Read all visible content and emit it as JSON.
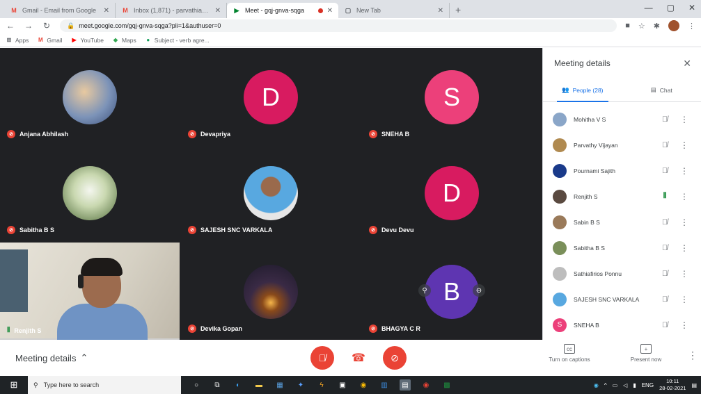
{
  "browser": {
    "tabs": [
      {
        "favicon": "gmail-icon",
        "title": "Gmail - Email from Google",
        "active": false
      },
      {
        "favicon": "gmail-icon",
        "title": "Inbox (1,871) - parvathiababu6...",
        "active": false
      },
      {
        "favicon": "meet-icon",
        "title": "Meet - gqj-gnva-sqga",
        "active": true
      },
      {
        "favicon": "newtab-icon",
        "title": "New Tab",
        "active": false
      }
    ],
    "url": "meet.google.com/gqj-gnva-sqga?pli=1&authuser=0",
    "bookmarks": [
      "Apps",
      "Gmail",
      "YouTube",
      "Maps",
      "Subject - verb agre..."
    ]
  },
  "tiles": [
    {
      "name": "Anjana Abhilash",
      "initial": "",
      "color": "#5b7fb5",
      "mic": "off"
    },
    {
      "name": "Devapriya",
      "initial": "D",
      "color": "#d81b60",
      "mic": "off"
    },
    {
      "name": "SNEHA B",
      "initial": "S",
      "color": "#ec407a",
      "mic": "off"
    },
    {
      "name": "Sabitha B S",
      "initial": "",
      "color": "#7a8f5a",
      "mic": "off"
    },
    {
      "name": "SAJESH SNC VARKALA",
      "initial": "",
      "color": "#58a8e0",
      "mic": "off"
    },
    {
      "name": "Devu Devu",
      "initial": "D",
      "color": "#d81b60",
      "mic": "off"
    },
    {
      "name": "Renjith S",
      "initial": "",
      "color": "",
      "mic": "on"
    },
    {
      "name": "Devika Gopan",
      "initial": "",
      "color": "#3a2a45",
      "mic": "off"
    },
    {
      "name": "BHAGYA C R",
      "initial": "B",
      "color": "#5e35b1",
      "mic": "off"
    }
  ],
  "panel": {
    "title": "Meeting details",
    "tabs": {
      "people": "People (28)",
      "chat": "Chat"
    },
    "people": [
      {
        "name": "Mohitha V S",
        "color": "#8aa6c8",
        "initial": "",
        "mic": "off"
      },
      {
        "name": "Parvathy Vijayan",
        "color": "#b08a50",
        "initial": "",
        "mic": "off"
      },
      {
        "name": "Pournami Sajith",
        "color": "#1a3a8a",
        "initial": "",
        "mic": "off"
      },
      {
        "name": "Renjith S",
        "color": "#5a4a40",
        "initial": "",
        "mic": "on"
      },
      {
        "name": "Sabin B S",
        "color": "#9a7a5a",
        "initial": "",
        "mic": "off"
      },
      {
        "name": "Sabitha B S",
        "color": "#7a8f5a",
        "initial": "",
        "mic": "off"
      },
      {
        "name": "Sathiafirios Ponnu",
        "color": "#bdbdbd",
        "initial": "",
        "mic": "off"
      },
      {
        "name": "SAJESH SNC VARKALA",
        "color": "#58a8e0",
        "initial": "",
        "mic": "off"
      },
      {
        "name": "SNEHA B",
        "color": "#ec407a",
        "initial": "S",
        "mic": "off"
      }
    ]
  },
  "bottom": {
    "meeting_details": "Meeting details",
    "captions": "Turn on captions",
    "present": "Present now"
  },
  "taskbar": {
    "search_placeholder": "Type here to search",
    "lang": "ENG",
    "time": "10:11",
    "date": "28-02-2021"
  }
}
